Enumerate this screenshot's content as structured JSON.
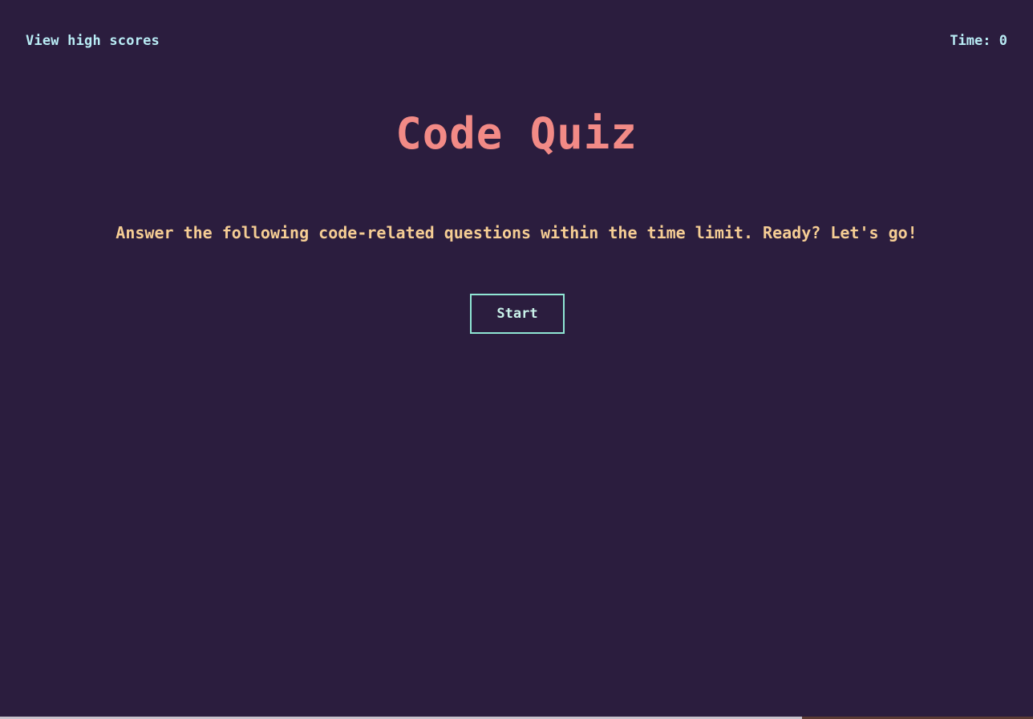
{
  "header": {
    "high_scores_label": "View high scores",
    "timer_label": "Time:",
    "timer_value": "0"
  },
  "main": {
    "title": "Code Quiz",
    "intro": "Answer the following code-related questions within the time limit. Ready? Let's go!",
    "start_label": "Start"
  },
  "colors": {
    "background": "#2b1d3e",
    "title": "#f28a86",
    "intro_text": "#f5cd94",
    "header_text": "#b9ecf5",
    "button_border": "#8fe6d4"
  }
}
